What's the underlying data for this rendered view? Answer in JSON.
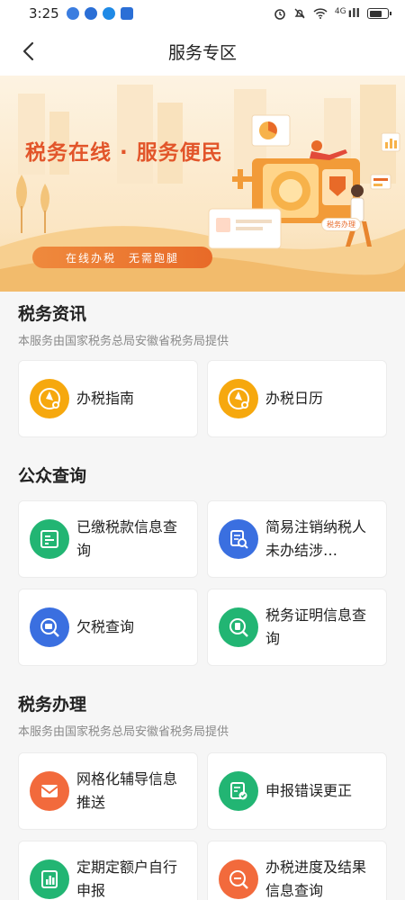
{
  "status_bar": {
    "time": "3:25",
    "network": "4G",
    "signal": "ıll",
    "app_icons": [
      "#3b7de0",
      "#2b6fd6",
      "#1f8ae6",
      "#2b6fd6"
    ],
    "right_icons": [
      "alarm-icon",
      "mute-icon",
      "wifi-icon",
      "signal-icon",
      "battery-icon"
    ]
  },
  "nav": {
    "title": "服务专区",
    "back_icon": "chevron-left-icon"
  },
  "banner": {
    "headline": "税务在线 · 服务便民",
    "tagline": "在线办税　无需跑腿",
    "badge": "税务办理"
  },
  "sections": {
    "news": {
      "title": "税务资讯",
      "subtitle": "本服务由国家税务总局安徽省税务局提供",
      "items": [
        {
          "label": "办税指南",
          "icon": "compass-icon",
          "color": "#f6a80e"
        },
        {
          "label": "办税日历",
          "icon": "compass-icon",
          "color": "#f6a80e"
        }
      ]
    },
    "query": {
      "title": "公众查询",
      "items": [
        {
          "label": "已缴税款信息查询",
          "icon": "receipt-icon",
          "color": "#22b573"
        },
        {
          "label": "简易注销纳税人未办结涉…",
          "icon": "document-search-icon",
          "color": "#3a6fe0"
        },
        {
          "label": "欠税查询",
          "icon": "tax-search-icon",
          "color": "#3a6fe0"
        },
        {
          "label": "税务证明信息查询",
          "icon": "certificate-search-icon",
          "color": "#22b573"
        }
      ]
    },
    "handle": {
      "title": "税务办理",
      "subtitle": "本服务由国家税务总局安徽省税务局提供",
      "items": [
        {
          "label": "网格化辅导信息推送",
          "icon": "envelope-icon",
          "color": "#f26a3c"
        },
        {
          "label": "申报错误更正",
          "icon": "form-check-icon",
          "color": "#22b573"
        },
        {
          "label": "定期定额户自行申报",
          "icon": "chart-report-icon",
          "color": "#22b573"
        },
        {
          "label": "办税进度及结果信息查询",
          "icon": "progress-search-icon",
          "color": "#f26a3c"
        }
      ]
    }
  }
}
